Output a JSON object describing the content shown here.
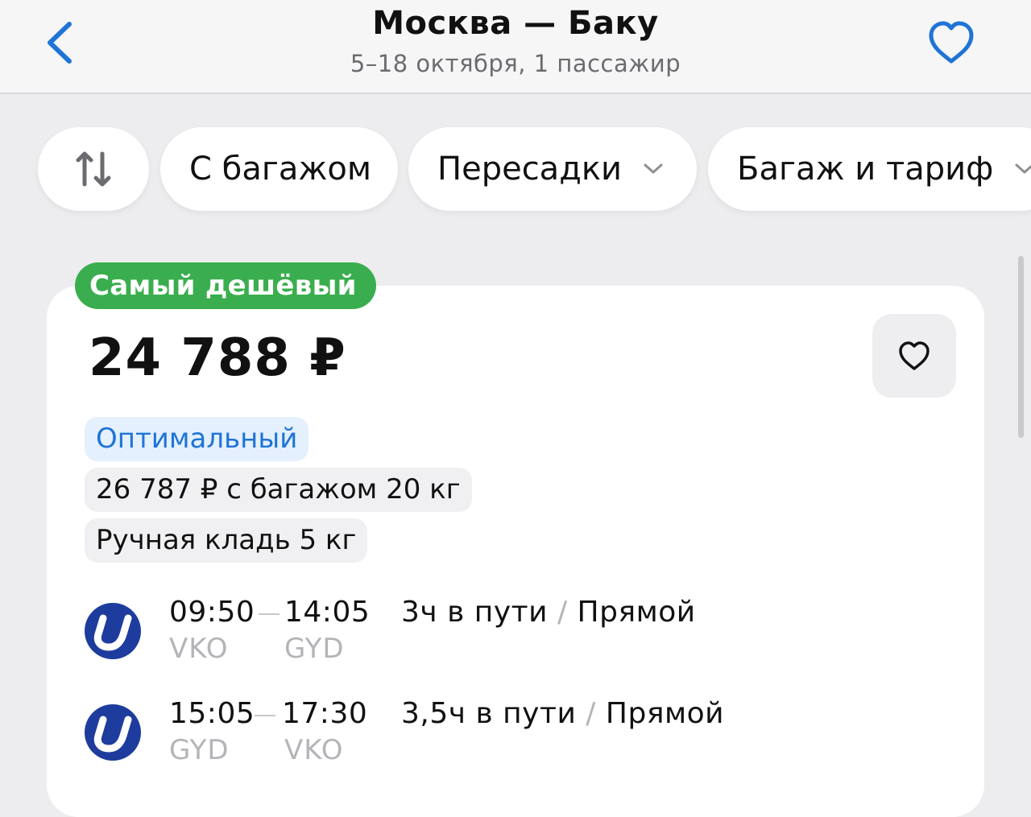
{
  "header": {
    "title": "Москва — Баку",
    "subtitle": "5–18 октября, 1 пассажир"
  },
  "filters": {
    "baggage": "С багажом",
    "transfers": "Пересадки",
    "tariff": "Багаж и тариф"
  },
  "offer": {
    "badge": "Самый дешёвый",
    "price": "24 788 ₽",
    "tags": {
      "optimal": "Оптимальный",
      "baggage": "26 787 ₽ с багажом 20 кг",
      "hand_luggage": "Ручная кладь 5 кг"
    },
    "flights": [
      {
        "depart_time": "09:50",
        "arrive_time": "14:05",
        "depart_code": "VKO",
        "arrive_code": "GYD",
        "duration": "3ч в пути",
        "separator": "/",
        "stops": "Прямой"
      },
      {
        "depart_time": "15:05",
        "arrive_time": "17:30",
        "depart_code": "GYD",
        "arrive_code": "VKO",
        "duration": "3,5ч в пути",
        "separator": "/",
        "stops": "Прямой"
      }
    ]
  },
  "colors": {
    "accent_blue": "#1f74d6",
    "badge_green": "#3aae4e",
    "airline_blue": "#1e3c9e"
  },
  "icons": {
    "back": "chevron-left-icon",
    "favorite": "heart-outline-icon",
    "sort": "sort-arrows-icon",
    "dropdown": "chevron-down-icon",
    "airline": "utair-logo-icon"
  }
}
